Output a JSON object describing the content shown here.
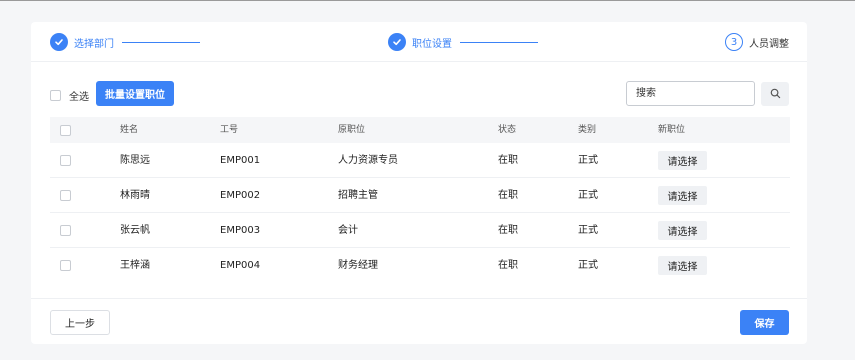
{
  "steps": [
    {
      "label": "选择部门",
      "number": "",
      "state": "done"
    },
    {
      "label": "职位设置",
      "number": "",
      "state": "done"
    },
    {
      "label": "人员调整",
      "number": "3",
      "state": "todo"
    }
  ],
  "toolbar": {
    "select_all_label": "全选",
    "batch_button": "批量设置职位",
    "search_placeholder": "搜索"
  },
  "table": {
    "headers": [
      "",
      "姓名",
      "工号",
      "原职位",
      "状态",
      "类别",
      "新职位"
    ],
    "rows": [
      {
        "name": "陈思远",
        "id": "EMP001",
        "position": "人力资源专员",
        "status": "在职",
        "type": "正式",
        "new_position": "请选择"
      },
      {
        "name": "林雨晴",
        "id": "EMP002",
        "position": "招聘主管",
        "status": "在职",
        "type": "正式",
        "new_position": "请选择"
      },
      {
        "name": "张云帆",
        "id": "EMP003",
        "position": "会计",
        "status": "在职",
        "type": "正式",
        "new_position": "请选择"
      },
      {
        "name": "王梓涵",
        "id": "EMP004",
        "position": "财务经理",
        "status": "在职",
        "type": "正式",
        "new_position": "请选择"
      }
    ]
  },
  "footer": {
    "prev_button": "上一步",
    "save_button": "保存"
  },
  "colors": {
    "accent": "#3b82f6",
    "page_bg": "#f5f6f8"
  },
  "icons": {
    "step_done": "check-icon",
    "search": "search-icon"
  }
}
